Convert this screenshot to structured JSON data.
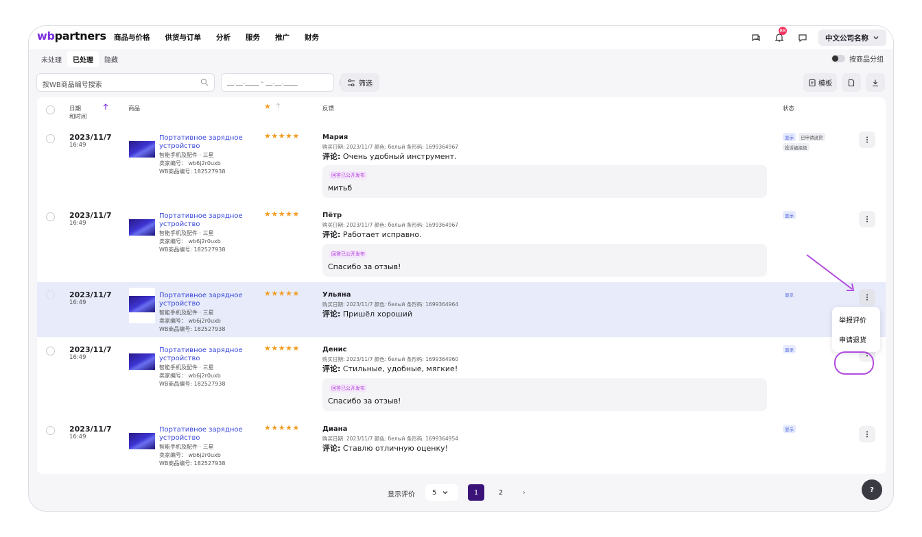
{
  "nav": {
    "logo_wb": "wb",
    "logo_rest": "partners",
    "items": [
      "商品与价格",
      "供货与订单",
      "分析",
      "服务",
      "推广",
      "财务"
    ],
    "notification_count": "88",
    "company": "中文公司名称"
  },
  "subtabs": [
    "未处理",
    "已处理",
    "隐藏"
  ],
  "group_toggle": "按商品分组",
  "toolbar": {
    "search_placeholder": "按WB商品编号搜索",
    "date_placeholder": "__.__.____ - __.__.____",
    "filter": "筛选",
    "template": "模板"
  },
  "columns": {
    "date": "日期",
    "datetime": "和时间",
    "product": "商品",
    "feedback": "反馈",
    "status": "状态"
  },
  "rows": [
    {
      "date": "2023/11/7",
      "time": "16:49",
      "product": "Портативное зарядное устройство",
      "category": "智能手机及配件 · 三星",
      "seller_code": "卖家编号： wb6j2r0uxb",
      "wb_code": "WB商品编号: 182527938",
      "stars": "★★★★★",
      "reviewer": "Мария",
      "meta": "购买日期: 2023/11/7   颜色: белый   条形码: 1699364967",
      "comment_label": "评论:",
      "comment": "Очень удобный инструмент.",
      "reply_tag": "回答已公开发布",
      "reply": "митьб",
      "status": [
        "显示",
        "已申请退货",
        "投诉被拒绝"
      ]
    },
    {
      "date": "2023/11/7",
      "time": "16:49",
      "product": "Портативное зарядное устройство",
      "category": "智能手机及配件 · 三星",
      "seller_code": "卖家编号： wb6j2r0uxb",
      "wb_code": "WB商品编号: 182527938",
      "stars": "★★★★★",
      "reviewer": "Пётр",
      "meta": "购买日期: 2023/11/7   颜色: белый   条形码: 1699364967",
      "comment_label": "评论:",
      "comment": "Работает исправно.",
      "reply_tag": "回答已公开发布",
      "reply": "Спасибо за отзыв!",
      "status": [
        "显示"
      ]
    },
    {
      "date": "2023/11/7",
      "time": "16:49",
      "product": "Портативное зарядное устройство",
      "category": "智能手机及配件 · 三星",
      "seller_code": "卖家编号： wb6j2r0uxb",
      "wb_code": "WB商品编号: 182527938",
      "stars": "★★★★★",
      "reviewer": "Ульяна",
      "meta": "购买日期: 2023/11/7   颜色: белый   条形码: 1699364964",
      "comment_label": "评论:",
      "comment": "Пришёл хороший",
      "status": [
        "显示"
      ]
    },
    {
      "date": "2023/11/7",
      "time": "16:49",
      "product": "Портативное зарядное устройство",
      "category": "智能手机及配件 · 三星",
      "seller_code": "卖家编号： wb6j2r0uxb",
      "wb_code": "WB商品编号: 182527938",
      "stars": "★★★★★",
      "reviewer": "Денис",
      "meta": "购买日期: 2023/11/7   颜色: белый   条形码: 1699364960",
      "comment_label": "评论:",
      "comment": "Стильные, удобные, мягкие!",
      "reply_tag": "回答已公开发布",
      "reply": "Спасибо за отзыв!",
      "status": [
        "显示"
      ]
    },
    {
      "date": "2023/11/7",
      "time": "16:49",
      "product": "Портативное зарядное устройство",
      "category": "智能手机及配件 · 三星",
      "seller_code": "卖家编号： wb6j2r0uxb",
      "wb_code": "WB商品编号: 182527938",
      "stars": "★★★★★",
      "reviewer": "Диана",
      "meta": "购买日期: 2023/11/7   颜色: белый   条形码: 1699364954",
      "comment_label": "评论:",
      "comment": "Ставлю отличную оценку!",
      "status": [
        "显示"
      ]
    }
  ],
  "menu": [
    "举报评价",
    "申请退货"
  ],
  "pagination": {
    "label": "显示评价",
    "per_page": "5",
    "pages": [
      "1",
      "2"
    ],
    "next": "›"
  },
  "help": "?",
  "colors": {
    "accent": "#3b1278",
    "link": "#3a48d8",
    "star": "#f29c1f",
    "highlight": "#b24ae0"
  }
}
